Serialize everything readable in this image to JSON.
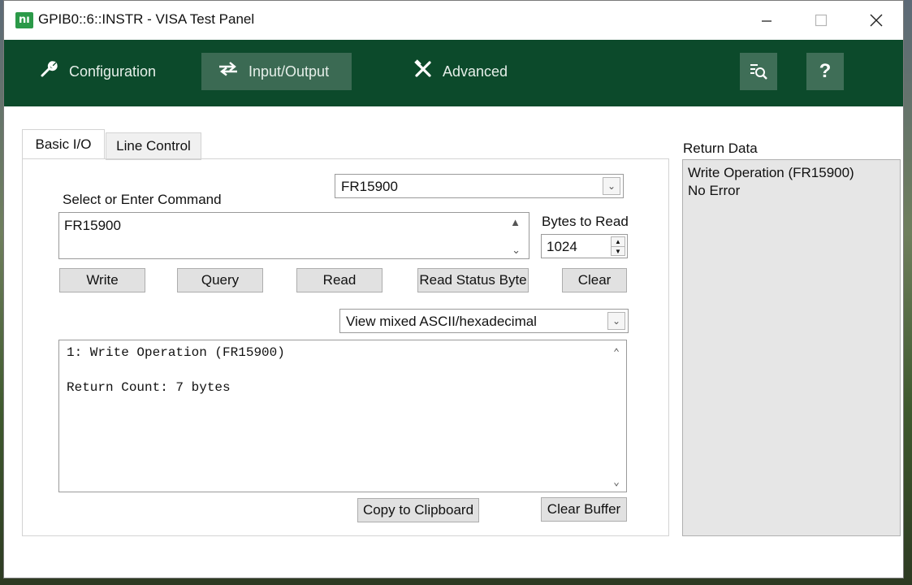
{
  "window": {
    "title": "GPIB0::6::INSTR - VISA Test Panel",
    "logo_text": "nı"
  },
  "toolbar": {
    "configuration": "Configuration",
    "input_output": "Input/Output",
    "advanced": "Advanced",
    "help": "?"
  },
  "tabs": {
    "basic_io": "Basic I/O",
    "line_control": "Line Control"
  },
  "command": {
    "label": "Select or Enter Command",
    "selected": "FR15900",
    "text": "FR15900"
  },
  "bytes_to_read": {
    "label": "Bytes to Read",
    "value": "1024"
  },
  "buttons": {
    "write": "Write",
    "query": "Query",
    "read": "Read",
    "read_status_byte": "Read Status Byte",
    "clear": "Clear",
    "copy_to_clipboard": "Copy to Clipboard",
    "clear_buffer": "Clear Buffer"
  },
  "view_mode": {
    "selected": "View mixed ASCII/hexadecimal"
  },
  "output": {
    "line1": "1: Write Operation (FR15900)",
    "line2": "Return Count: 7 bytes"
  },
  "return_data": {
    "label": "Return Data",
    "line1": "Write Operation (FR15900)",
    "line2": "No Error"
  },
  "colors": {
    "toolbar_bg": "#0c4a2b",
    "active_tab_bg": "#3b6a53",
    "logo_green": "#2b9948"
  }
}
